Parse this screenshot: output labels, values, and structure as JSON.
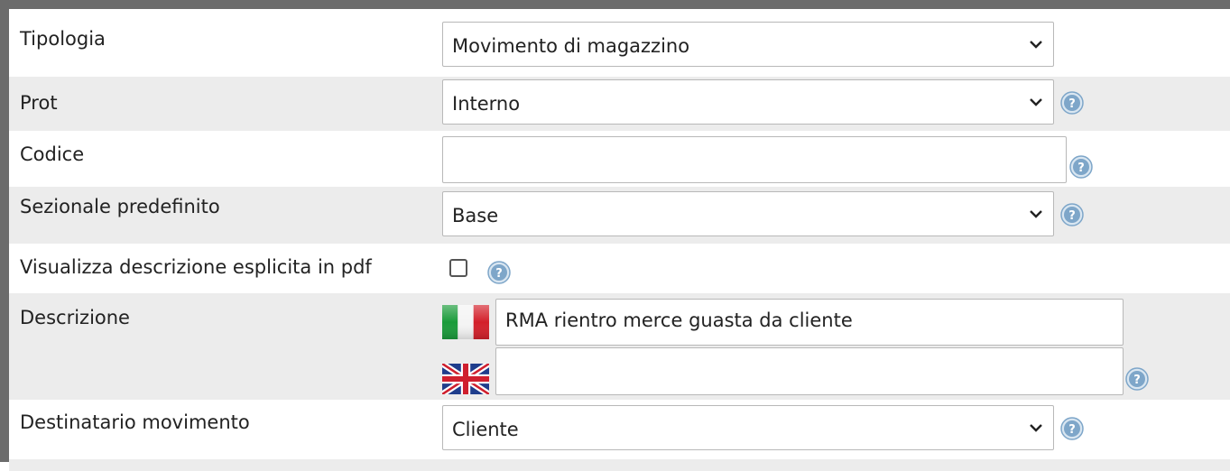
{
  "form": {
    "tipologia": {
      "label": "Tipologia",
      "value": "Movimento di magazzino"
    },
    "prot": {
      "label": "Prot",
      "value": "Interno"
    },
    "codice": {
      "label": "Codice",
      "value": ""
    },
    "sezionale": {
      "label": "Sezionale predefinito",
      "value": "Base"
    },
    "visualizza": {
      "label": "Visualizza descrizione esplicita in pdf",
      "checked": false
    },
    "descrizione": {
      "label": "Descrizione",
      "it_value": "RMA rientro merce guasta da cliente",
      "en_value": ""
    },
    "destinatario": {
      "label": "Destinatario movimento",
      "value": "Cliente"
    }
  },
  "icons": {
    "help": "help-icon",
    "chevron": "chevron-down-icon",
    "flag_it": "italy-flag-icon",
    "flag_uk": "uk-flag-icon"
  },
  "colors": {
    "frame": "#6b6b6b",
    "row_alt": "#ececec",
    "help_blue": "#7ea6c9"
  }
}
